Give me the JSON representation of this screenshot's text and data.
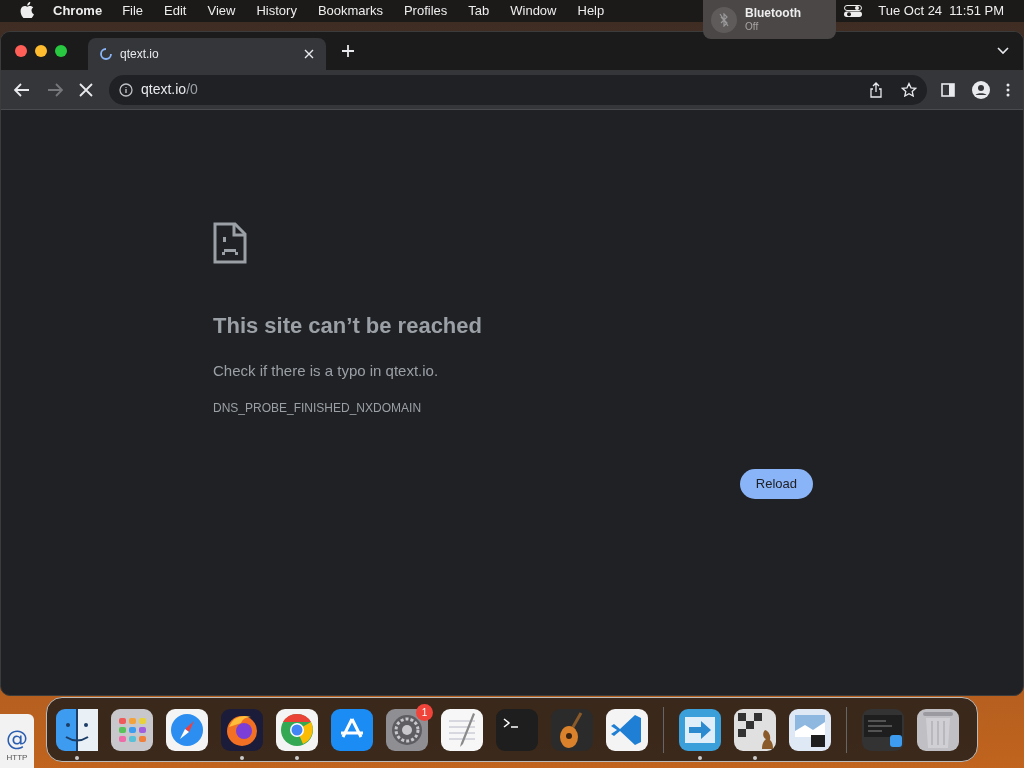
{
  "menu_bar": {
    "app_name": "Chrome",
    "items": [
      "File",
      "Edit",
      "View",
      "History",
      "Bookmarks",
      "Profiles",
      "Tab",
      "Window",
      "Help"
    ],
    "clock": "Tue Oct 24  11:51 PM"
  },
  "notification": {
    "title": "Bluetooth",
    "subtitle": "Off"
  },
  "browser": {
    "tabs": [
      {
        "title": "qtext.io",
        "loading": true,
        "selected": true
      }
    ],
    "address_bar": {
      "host": "qtext.io",
      "path": "/0"
    },
    "loading": true
  },
  "error_page": {
    "title": "This site can’t be reached",
    "message": "Check if there is a typo in qtext.io.",
    "code": "DNS_PROBE_FINISHED_NXDOMAIN",
    "button": "Reload"
  },
  "desktop_file": {
    "glyph": "@",
    "label": "HTTP"
  },
  "dock": {
    "items": [
      {
        "kind": "finder",
        "running": true
      },
      {
        "kind": "launchpad",
        "running": false
      },
      {
        "kind": "safari",
        "running": false
      },
      {
        "kind": "firefox",
        "running": true
      },
      {
        "kind": "chrome",
        "running": true
      },
      {
        "kind": "appstore",
        "running": false
      },
      {
        "kind": "settings",
        "running": false,
        "badge": "1"
      },
      {
        "kind": "textedit",
        "running": false
      },
      {
        "kind": "terminal",
        "running": false
      },
      {
        "kind": "guitar",
        "running": false
      },
      {
        "kind": "vscode",
        "running": false
      },
      {
        "kind": "separator"
      },
      {
        "kind": "migration",
        "running": true
      },
      {
        "kind": "chess",
        "running": true
      },
      {
        "kind": "preview",
        "running": false
      },
      {
        "kind": "separator"
      },
      {
        "kind": "window",
        "running": false
      },
      {
        "kind": "trash",
        "running": false
      }
    ]
  }
}
